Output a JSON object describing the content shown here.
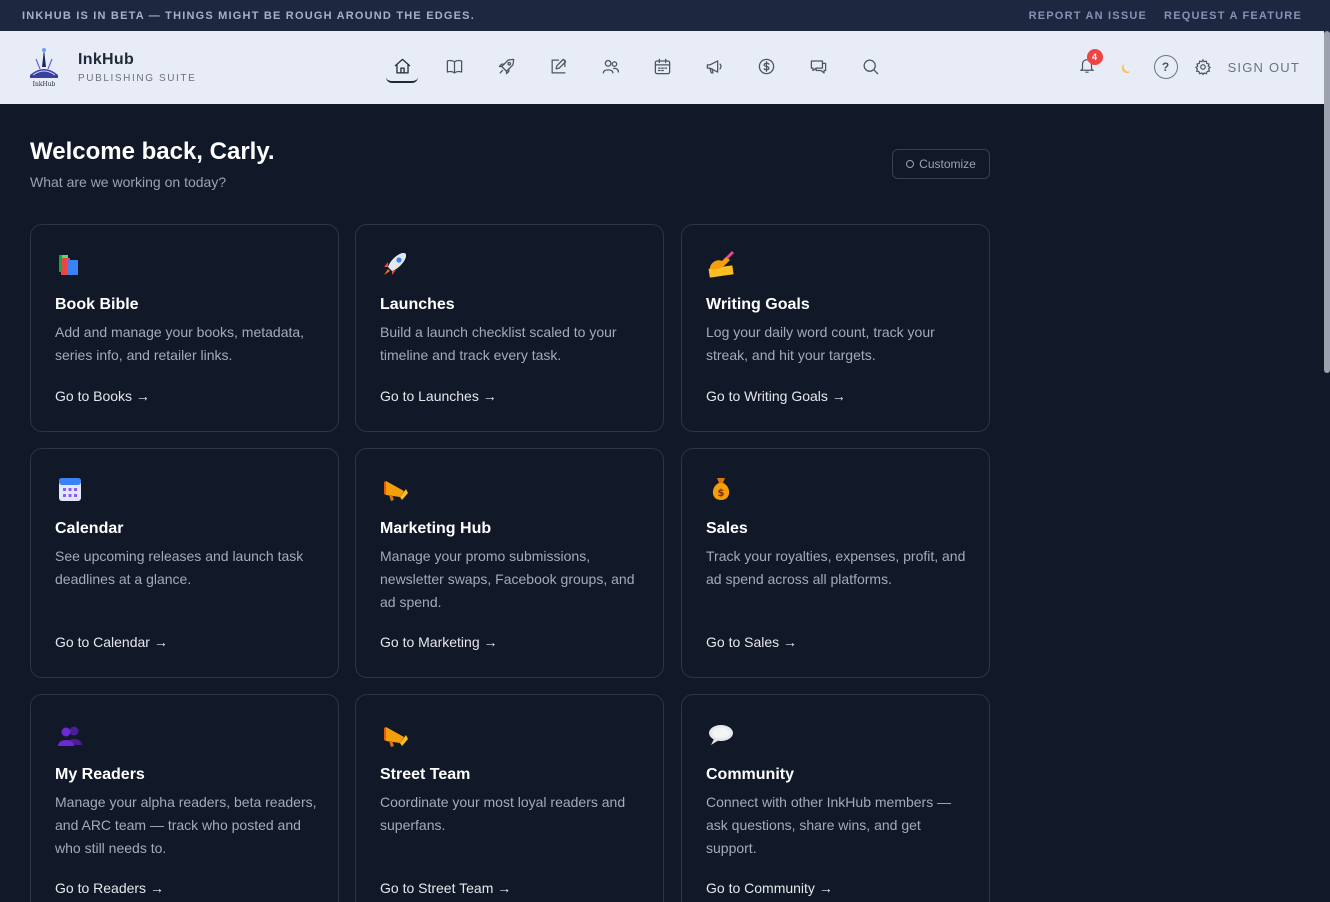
{
  "beta_bar": {
    "text": "INKHUB IS IN BETA — THINGS MIGHT BE ROUGH AROUND THE EDGES.",
    "report_issue": "REPORT AN ISSUE",
    "request_feature": "REQUEST A FEATURE"
  },
  "brand": {
    "name": "InkHub",
    "subtitle": "PUBLISHING SUITE",
    "logo_text": "InkHub"
  },
  "nav": {
    "icons": [
      "home-icon",
      "book-icon",
      "rocket-icon",
      "pencil-icon",
      "users-icon",
      "calendar-icon",
      "megaphone-icon",
      "dollar-icon",
      "chat-icon",
      "search-icon"
    ],
    "active": "home-icon"
  },
  "tools": {
    "notifications_count": "4",
    "help": "?",
    "signout": "SIGN OUT"
  },
  "welcome": {
    "title": "Welcome back, Carly.",
    "subtitle": "What are we working on today?",
    "customize": "Customize"
  },
  "cards": [
    {
      "emoji": "books",
      "title": "Book Bible",
      "desc": "Add and manage your books, metadata, series info, and retailer links.",
      "link": "Go to Books →"
    },
    {
      "emoji": "rocket",
      "title": "Launches",
      "desc": "Build a launch checklist scaled to your timeline and track every task.",
      "link": "Go to Launches →"
    },
    {
      "emoji": "writing-hand",
      "title": "Writing Goals",
      "desc": "Log your daily word count, track your streak, and hit your targets.",
      "link": "Go to Writing Goals →"
    },
    {
      "emoji": "calendar",
      "title": "Calendar",
      "desc": "See upcoming releases and launch task deadlines at a glance.",
      "link": "Go to Calendar →"
    },
    {
      "emoji": "megaphone",
      "title": "Marketing Hub",
      "desc": "Manage your promo submissions, newsletter swaps, Facebook groups, and ad spend.",
      "link": "Go to Marketing →"
    },
    {
      "emoji": "money-bag",
      "title": "Sales",
      "desc": "Track your royalties, expenses, profit, and ad spend across all platforms.",
      "link": "Go to Sales →"
    },
    {
      "emoji": "people",
      "title": "My Readers",
      "desc": "Manage your alpha readers, beta readers, and ARC team — track who posted and who still needs to.",
      "link": "Go to Readers →"
    },
    {
      "emoji": "megaphone",
      "title": "Street Team",
      "desc": "Coordinate your most loyal readers and superfans.",
      "link": "Go to Street Team →"
    },
    {
      "emoji": "speech-balloon",
      "title": "Community",
      "desc": "Connect with other InkHub members — ask questions, share wins, and get support.",
      "link": "Go to Community →"
    }
  ],
  "colors": {
    "background": "#111827",
    "topbar": "#1e2740",
    "nav": "#e8ecf6",
    "badge": "#ef4444"
  }
}
